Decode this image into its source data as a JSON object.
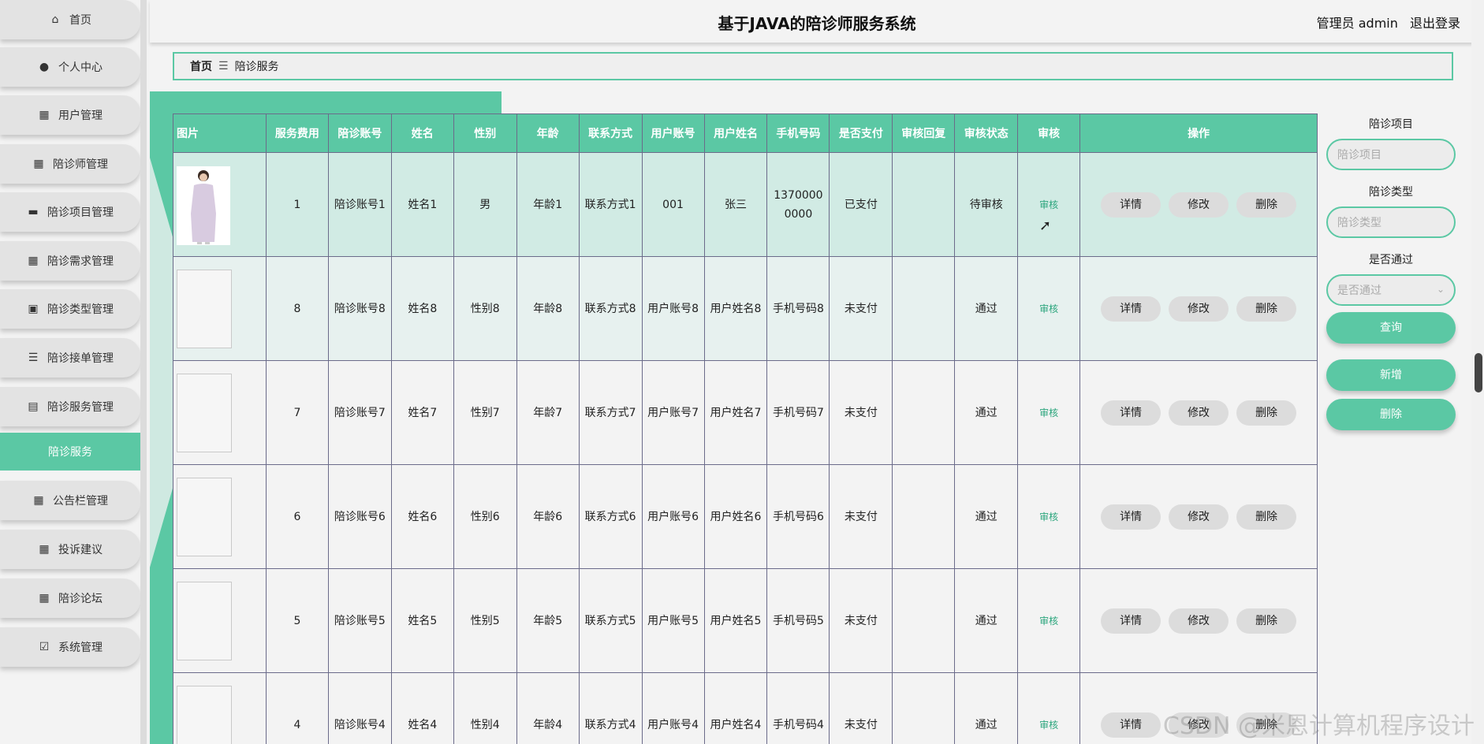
{
  "header": {
    "title": "基于JAVA的陪诊师服务系统",
    "user_label": "管理员 admin",
    "logout_label": "退出登录"
  },
  "sidebar": {
    "items": [
      {
        "label": "首页",
        "icon": "home-icon"
      },
      {
        "label": "个人中心",
        "icon": "user-icon"
      },
      {
        "label": "用户管理",
        "icon": "grid-icon"
      },
      {
        "label": "陪诊师管理",
        "icon": "grid-icon"
      },
      {
        "label": "陪诊项目管理",
        "icon": "ticket-icon"
      },
      {
        "label": "陪诊需求管理",
        "icon": "grid-icon"
      },
      {
        "label": "陪诊类型管理",
        "icon": "briefcase-icon"
      },
      {
        "label": "陪诊接单管理",
        "icon": "list-icon"
      },
      {
        "label": "陪诊服务管理",
        "icon": "clipboard-icon"
      },
      {
        "label": "陪诊服务",
        "icon": ""
      },
      {
        "label": "公告栏管理",
        "icon": "grid-icon"
      },
      {
        "label": "投诉建议",
        "icon": "grid-icon"
      },
      {
        "label": "陪诊论坛",
        "icon": "grid-icon"
      },
      {
        "label": "系统管理",
        "icon": "clipboard-check-icon"
      }
    ]
  },
  "breadcrumb": {
    "home": "首页",
    "separator": "☰",
    "current": "陪诊服务"
  },
  "table": {
    "headers": [
      "图片",
      "服务费用",
      "陪诊账号",
      "姓名",
      "性别",
      "年龄",
      "联系方式",
      "用户账号",
      "用户姓名",
      "手机号码",
      "是否支付",
      "审核回复",
      "审核状态",
      "审核",
      "操作"
    ],
    "audit_label": "审核",
    "detail_label": "详情",
    "edit_label": "修改",
    "delete_label": "删除",
    "rows": [
      {
        "fee": "1",
        "account": "陪诊账号1",
        "name": "姓名1",
        "gender": "男",
        "age": "年龄1",
        "contact": "联系方式1",
        "user_account": "001",
        "user_name": "张三",
        "phone": "13700000000",
        "paid": "已支付",
        "reply": "",
        "status": "待审核"
      },
      {
        "fee": "8",
        "account": "陪诊账号8",
        "name": "姓名8",
        "gender": "性别8",
        "age": "年龄8",
        "contact": "联系方式8",
        "user_account": "用户账号8",
        "user_name": "用户姓名8",
        "phone": "手机号码8",
        "paid": "未支付",
        "reply": "",
        "status": "通过"
      },
      {
        "fee": "7",
        "account": "陪诊账号7",
        "name": "姓名7",
        "gender": "性别7",
        "age": "年龄7",
        "contact": "联系方式7",
        "user_account": "用户账号7",
        "user_name": "用户姓名7",
        "phone": "手机号码7",
        "paid": "未支付",
        "reply": "",
        "status": "通过"
      },
      {
        "fee": "6",
        "account": "陪诊账号6",
        "name": "姓名6",
        "gender": "性别6",
        "age": "年龄6",
        "contact": "联系方式6",
        "user_account": "用户账号6",
        "user_name": "用户姓名6",
        "phone": "手机号码6",
        "paid": "未支付",
        "reply": "",
        "status": "通过"
      },
      {
        "fee": "5",
        "account": "陪诊账号5",
        "name": "姓名5",
        "gender": "性别5",
        "age": "年龄5",
        "contact": "联系方式5",
        "user_account": "用户账号5",
        "user_name": "用户姓名5",
        "phone": "手机号码5",
        "paid": "未支付",
        "reply": "",
        "status": "通过"
      },
      {
        "fee": "4",
        "account": "陪诊账号4",
        "name": "姓名4",
        "gender": "性别4",
        "age": "年龄4",
        "contact": "联系方式4",
        "user_account": "用户账号4",
        "user_name": "用户姓名4",
        "phone": "手机号码4",
        "paid": "未支付",
        "reply": "",
        "status": "通过"
      }
    ]
  },
  "search": {
    "project_label": "陪诊项目",
    "project_placeholder": "陪诊项目",
    "type_label": "陪诊类型",
    "type_placeholder": "陪诊类型",
    "pass_label": "是否通过",
    "pass_placeholder": "是否通过",
    "query_button": "查询",
    "add_button": "新增",
    "delete_button": "删除"
  },
  "watermark": "CSDN @米恩计算机程序设计",
  "colors": {
    "accent": "#5bc8a4",
    "first_row_bg": "#d1ebe4",
    "audit_link": "#2aa57c"
  }
}
